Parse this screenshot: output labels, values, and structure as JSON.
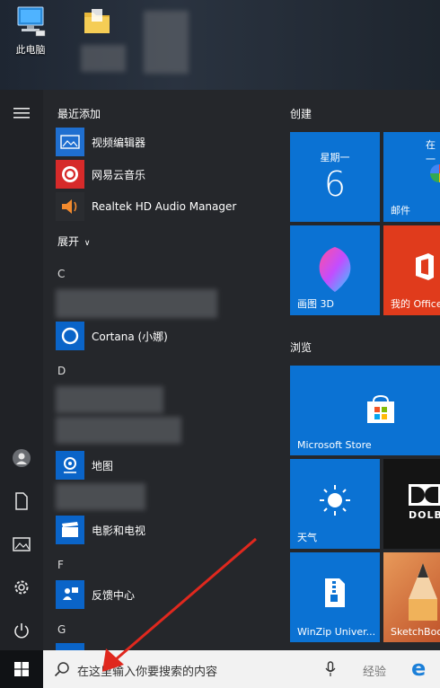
{
  "desktop": {
    "this_pc_label": "此电脑"
  },
  "start_menu": {
    "rail": {
      "items": [
        "hamburger-icon",
        "user-icon",
        "documents-icon",
        "pictures-icon",
        "settings-icon",
        "power-icon"
      ]
    },
    "recent_header": "最近添加",
    "recent_apps": [
      {
        "label": "视频编辑器",
        "icon": "video-editor-icon",
        "color": "#1f6fd0"
      },
      {
        "label": "网易云音乐",
        "icon": "netease-music-icon",
        "color": "#d62a2a"
      },
      {
        "label": "Realtek HD Audio Manager",
        "icon": "speaker-icon",
        "color": "#2a2c30"
      }
    ],
    "expand_label": "展开",
    "sections": [
      {
        "letter": "C",
        "items": [
          {
            "label": "Cortana (小娜)",
            "icon": "cortana-icon",
            "color": "#0a64c8"
          }
        ]
      },
      {
        "letter": "D",
        "items": [
          {
            "label": "地图",
            "icon": "maps-icon",
            "color": "#0a64c8"
          },
          {
            "label": "电影和电视",
            "icon": "movies-icon",
            "color": "#0a64c8"
          }
        ]
      },
      {
        "letter": "F",
        "items": [
          {
            "label": "反馈中心",
            "icon": "feedback-icon",
            "color": "#0a64c8"
          }
        ]
      },
      {
        "letter": "G",
        "items": []
      }
    ]
  },
  "tiles": {
    "group_create": "创建",
    "group_browse": "浏览",
    "calendar": {
      "weekday": "星期一",
      "day": "6"
    },
    "mail_top": "在一",
    "mail_label": "邮件",
    "paint3d_label": "画图 3D",
    "office_label": "我的 Office",
    "store_label": "Microsoft Store",
    "weather_label": "天气",
    "dolby_label": "DOLB",
    "winzip_label": "WinZip Univer...",
    "sketchbook_label": "SketchBoo",
    "accent": "#0b72d3",
    "office_color": "#e03b1c",
    "dolby_color": "#141414"
  },
  "taskbar": {
    "search_placeholder": "在这里输入你要搜索的内容",
    "watermark": "经验"
  }
}
